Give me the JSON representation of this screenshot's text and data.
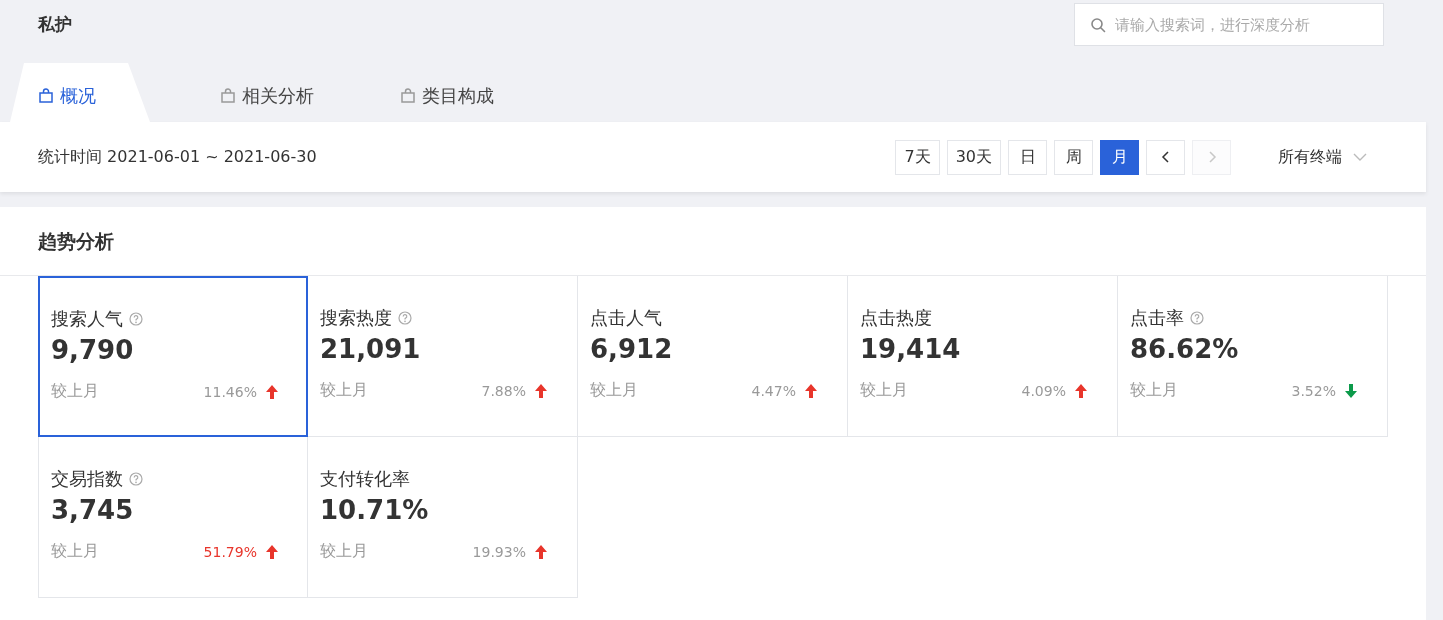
{
  "title": "私护",
  "search": {
    "placeholder": "请输入搜索词，进行深度分析"
  },
  "tabs": [
    {
      "label": "概况",
      "selected": true
    },
    {
      "label": "相关分析",
      "selected": false
    },
    {
      "label": "类目构成",
      "selected": false
    }
  ],
  "date_range": "统计时间 2021-06-01 ~ 2021-06-30",
  "period_buttons": [
    {
      "label": "7天",
      "selected": false
    },
    {
      "label": "30天",
      "selected": false
    },
    {
      "label": "日",
      "selected": false
    },
    {
      "label": "周",
      "selected": false
    },
    {
      "label": "月",
      "selected": true
    }
  ],
  "pager": [
    {
      "kind": "prev",
      "disabled": false
    },
    {
      "kind": "next",
      "disabled": true
    }
  ],
  "terminal": "所有终端",
  "section_title": "趋势分析",
  "metrics": [
    {
      "label": "搜索人气",
      "help": true,
      "value": "9,790",
      "compare": "较上月",
      "change": "11.46%",
      "kind": "up",
      "emphasis": false,
      "selected": true
    },
    {
      "label": "搜索热度",
      "help": true,
      "value": "21,091",
      "compare": "较上月",
      "change": "7.88%",
      "kind": "up",
      "emphasis": false,
      "selected": false
    },
    {
      "label": "点击人气",
      "help": false,
      "value": "6,912",
      "compare": "较上月",
      "change": "4.47%",
      "kind": "up",
      "emphasis": false,
      "selected": false
    },
    {
      "label": "点击热度",
      "help": false,
      "value": "19,414",
      "compare": "较上月",
      "change": "4.09%",
      "kind": "up",
      "emphasis": false,
      "selected": false
    },
    {
      "label": "点击率",
      "help": true,
      "value": "86.62%",
      "compare": "较上月",
      "change": "3.52%",
      "kind": "down",
      "emphasis": false,
      "selected": false
    },
    {
      "label": "交易指数",
      "help": true,
      "value": "3,745",
      "compare": "较上月",
      "change": "51.79%",
      "kind": "up",
      "emphasis": true,
      "selected": false
    },
    {
      "label": "支付转化率",
      "help": false,
      "value": "10.71%",
      "compare": "较上月",
      "change": "19.93%",
      "kind": "up",
      "emphasis": false,
      "selected": false
    }
  ]
}
